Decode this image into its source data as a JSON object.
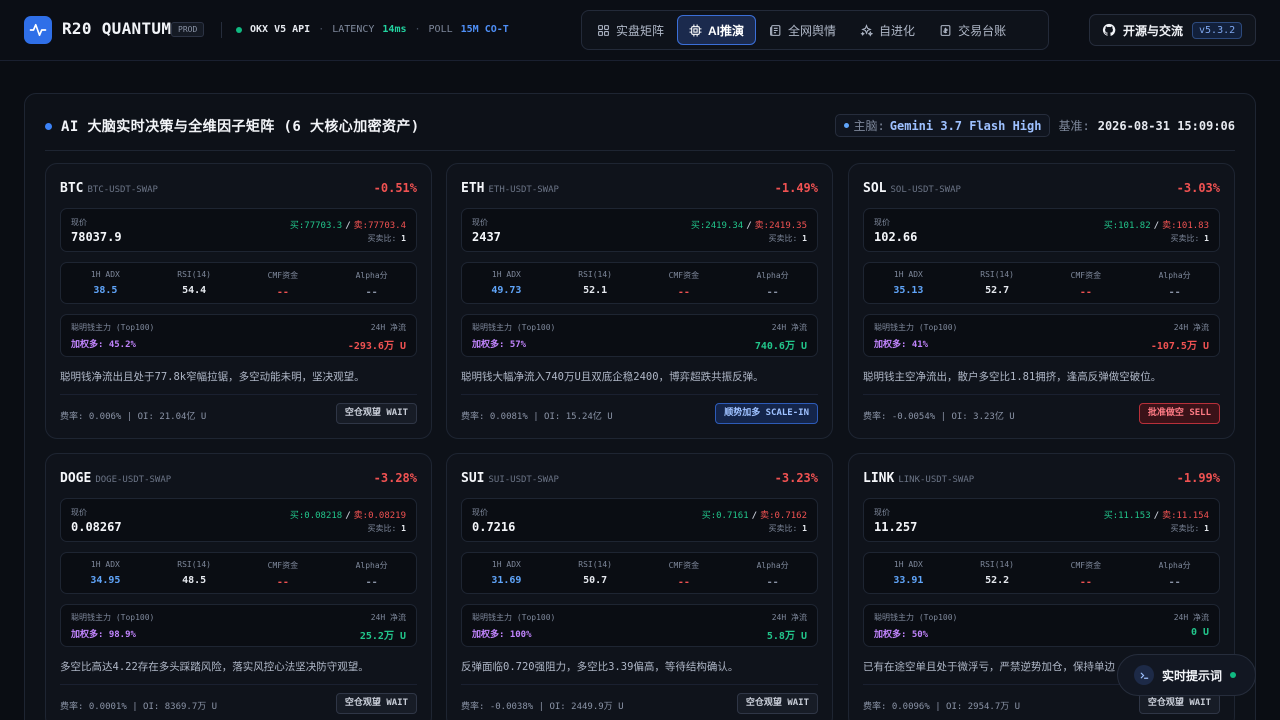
{
  "header": {
    "brand": "R20 QUANTUM",
    "env_badge": "PROD",
    "api_status": "OKX V5 API",
    "latency_label": "LATENCY",
    "latency_value": "14ms",
    "poll_label": "POLL",
    "poll_value": "15M CO-T",
    "nav": [
      {
        "label": "实盘矩阵",
        "icon": "grid-icon",
        "active": false
      },
      {
        "label": "AI推演",
        "icon": "cpu-icon",
        "active": true
      },
      {
        "label": "全网舆情",
        "icon": "newspaper-icon",
        "active": false
      },
      {
        "label": "自进化",
        "icon": "sparkles-icon",
        "active": false
      },
      {
        "label": "交易台账",
        "icon": "ledger-icon",
        "active": false
      }
    ],
    "github_label": "开源与交流",
    "version": "v5.3.2"
  },
  "panel": {
    "title": "AI 大脑实时决策与全维因子矩阵 (6 大核心加密资产)",
    "brain_label": "主脑:",
    "brain_model": "Gemini 3.7 Flash High",
    "bench_label": "基准:",
    "bench_time": "2026-08-31 15:09:06"
  },
  "labels": {
    "price": "现价",
    "buy_prefix": "买:",
    "sell_prefix": "卖:",
    "ratio": "买卖比:",
    "adx": "1H ADX",
    "rsi": "RSI(14)",
    "cmf": "CMF资金",
    "alpha": "Alpha分",
    "smart_money": "聪明钱主力 (Top100)",
    "net_flow": "24H 净流",
    "long_prefix": "加权多:",
    "funding_prefix": "费率:",
    "oi_prefix": "OI:"
  },
  "cards": [
    {
      "symbol": "BTC",
      "pair": "BTC-USDT-SWAP",
      "change": "-0.51%",
      "price": "78037.9",
      "bid": "77703.3",
      "ask": "77703.4",
      "ratio": "1",
      "adx": "38.5",
      "rsi": "54.4",
      "cmf": "--",
      "alpha": "--",
      "long": "45.2%",
      "flow": "-293.6万 U",
      "flow_dir": "neg",
      "note": "聪明钱净流出且处于77.8k窄幅拉锯，多空动能未明，坚决观望。",
      "funding": "0.006%",
      "oi": "21.04亿 U",
      "badge": "空仓观望 WAIT",
      "badge_type": "wait"
    },
    {
      "symbol": "ETH",
      "pair": "ETH-USDT-SWAP",
      "change": "-1.49%",
      "price": "2437",
      "bid": "2419.34",
      "ask": "2419.35",
      "ratio": "1",
      "adx": "49.73",
      "rsi": "52.1",
      "cmf": "--",
      "alpha": "--",
      "long": "57%",
      "flow": "740.6万 U",
      "flow_dir": "pos",
      "note": "聪明钱大幅净流入740万U且双底企稳2400，博弈超跌共振反弹。",
      "funding": "0.0081%",
      "oi": "15.24亿 U",
      "badge": "顺势加多 SCALE-IN",
      "badge_type": "scale"
    },
    {
      "symbol": "SOL",
      "pair": "SOL-USDT-SWAP",
      "change": "-3.03%",
      "price": "102.66",
      "bid": "101.82",
      "ask": "101.83",
      "ratio": "1",
      "adx": "35.13",
      "rsi": "52.7",
      "cmf": "--",
      "alpha": "--",
      "long": "41%",
      "flow": "-107.5万 U",
      "flow_dir": "neg",
      "note": "聪明钱主空净流出，散户多空比1.81拥挤，逢高反弹做空破位。",
      "funding": "-0.0054%",
      "oi": "3.23亿 U",
      "badge": "批准做空 SELL",
      "badge_type": "sell"
    },
    {
      "symbol": "DOGE",
      "pair": "DOGE-USDT-SWAP",
      "change": "-3.28%",
      "price": "0.08267",
      "bid": "0.08218",
      "ask": "0.08219",
      "ratio": "1",
      "adx": "34.95",
      "rsi": "48.5",
      "cmf": "--",
      "alpha": "--",
      "long": "98.9%",
      "flow": "25.2万 U",
      "flow_dir": "pos",
      "note": "多空比高达4.22存在多头踩踏风险，落实风控心法坚决防守观望。",
      "funding": "0.0001%",
      "oi": "8369.7万 U",
      "badge": "空仓观望 WAIT",
      "badge_type": "wait"
    },
    {
      "symbol": "SUI",
      "pair": "SUI-USDT-SWAP",
      "change": "-3.23%",
      "price": "0.7216",
      "bid": "0.7161",
      "ask": "0.7162",
      "ratio": "1",
      "adx": "31.69",
      "rsi": "50.7",
      "cmf": "--",
      "alpha": "--",
      "long": "100%",
      "flow": "5.8万 U",
      "flow_dir": "pos",
      "note": "反弹面临0.720强阻力，多空比3.39偏高，等待结构确认。",
      "funding": "-0.0038%",
      "oi": "2449.9万 U",
      "badge": "空仓观望 WAIT",
      "badge_type": "wait"
    },
    {
      "symbol": "LINK",
      "pair": "LINK-USDT-SWAP",
      "change": "-1.99%",
      "price": "11.257",
      "bid": "11.153",
      "ask": "11.154",
      "ratio": "1",
      "adx": "33.91",
      "rsi": "52.2",
      "cmf": "--",
      "alpha": "--",
      "long": "50%",
      "flow": "0 U",
      "flow_dir": "pos",
      "note": "已有在途空单且处于微浮亏，严禁逆势加仓，保持单边",
      "funding": "0.0096%",
      "oi": "2954.7万 U",
      "badge": "空仓观望 WAIT",
      "badge_type": "wait"
    }
  ],
  "float_button": {
    "label": "实时提示词",
    "icon": "terminal-icon"
  },
  "colors": {
    "background": "#0a0d13",
    "accent": "#2f6fe8",
    "positive": "#22c58b",
    "negative": "#f05252",
    "smart_money_long": "#c084fc"
  }
}
